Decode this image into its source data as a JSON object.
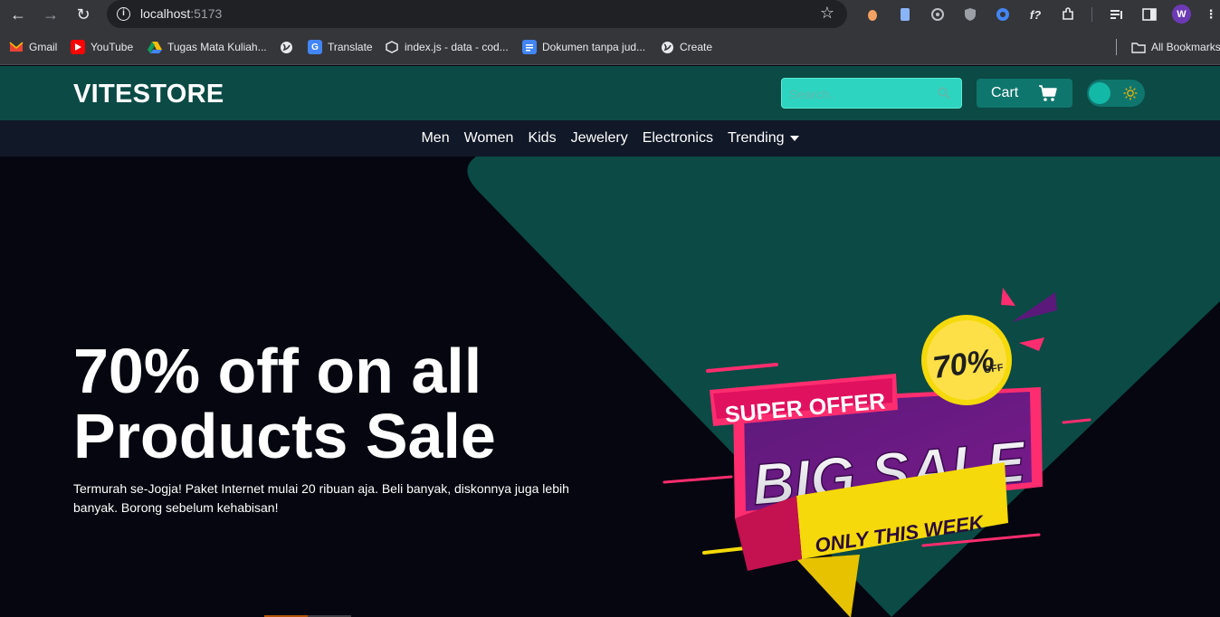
{
  "browser": {
    "url_host": "localhost",
    "url_port": ":5173",
    "profile_initial": "W",
    "bookmarks": [
      {
        "label": "Gmail",
        "icon": "gmail-icon"
      },
      {
        "label": "YouTube",
        "icon": "youtube-icon"
      },
      {
        "label": "Tugas Mata Kuliah...",
        "icon": "drive-icon"
      },
      {
        "label": "",
        "icon": "globe-icon"
      },
      {
        "label": "Translate",
        "icon": "translate-icon"
      },
      {
        "label": "index.js - data - cod...",
        "icon": "codesandbox-icon"
      },
      {
        "label": "Dokumen tanpa jud...",
        "icon": "docs-icon"
      },
      {
        "label": "Create",
        "icon": "globe-icon"
      }
    ],
    "all_bookmarks": "All Bookmarks"
  },
  "header": {
    "logo": "VITESTORE",
    "search_placeholder": "Search..",
    "cart_label": "Cart"
  },
  "nav": {
    "categories": [
      "Men",
      "Women",
      "Kids",
      "Jewelery",
      "Electronics"
    ],
    "trending": "Trending"
  },
  "hero": {
    "title": "70% off on all Products Sale",
    "subtitle": "Termurah se-Jogja! Paket Internet mulai 20 ribuan aja. Beli banyak, diskonnya juga lebih banyak. Borong sebelum kehabisan!",
    "promo": {
      "badge_number": "70%",
      "badge_word": "OFF",
      "ribbon_top": "SUPER OFFER",
      "headline": "BIG SALE",
      "ribbon_bottom": "ONLY THIS WEEK"
    }
  },
  "colors": {
    "header_bg": "#0b4a45",
    "nav_bg": "#111827",
    "hero_bg": "#05060f",
    "accent": "#2dd4bf",
    "shape": "#0b4a45"
  }
}
